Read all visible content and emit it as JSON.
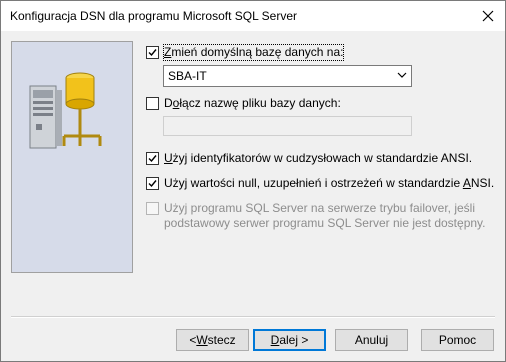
{
  "window": {
    "title": "Konfiguracja DSN dla programu Microsoft SQL Server"
  },
  "options": {
    "change_db": {
      "checked": true,
      "prefix": "",
      "hot": "Z",
      "rest": "mień domyślną bazę danych na:"
    },
    "db_select": {
      "value": "SBA-IT"
    },
    "attach": {
      "checked": false,
      "prefix": "D",
      "hot": "o",
      "rest": "łącz nazwę pliku bazy danych:"
    },
    "ansi_quoted": {
      "checked": true,
      "prefix": "",
      "hot": "U",
      "rest": "żyj identyfikatorów w cudzysłowach w standardzie ANSI."
    },
    "ansi_nulls": {
      "checked": true,
      "prefix": "Użyj wartości null, uzupełnień i ostrzeżeń w standardzie ",
      "hot": "A",
      "rest": "NSI."
    },
    "failover": {
      "checked": false,
      "line1": "Użyj programu SQL Server na serwerze trybu failover, jeśli",
      "line2": "podstawowy serwer programu SQL Server nie jest dostępny."
    }
  },
  "buttons": {
    "back": {
      "prefix": "< ",
      "hot": "W",
      "rest": "stecz"
    },
    "next": {
      "prefix": "",
      "hot": "D",
      "rest": "alej >"
    },
    "cancel": {
      "label": "Anuluj"
    },
    "help": {
      "label": "Pomoc"
    }
  },
  "icons": {
    "close": "close-icon",
    "server": "server-database-icon",
    "check": "check-icon",
    "dropdown": "chevron-down-icon"
  }
}
